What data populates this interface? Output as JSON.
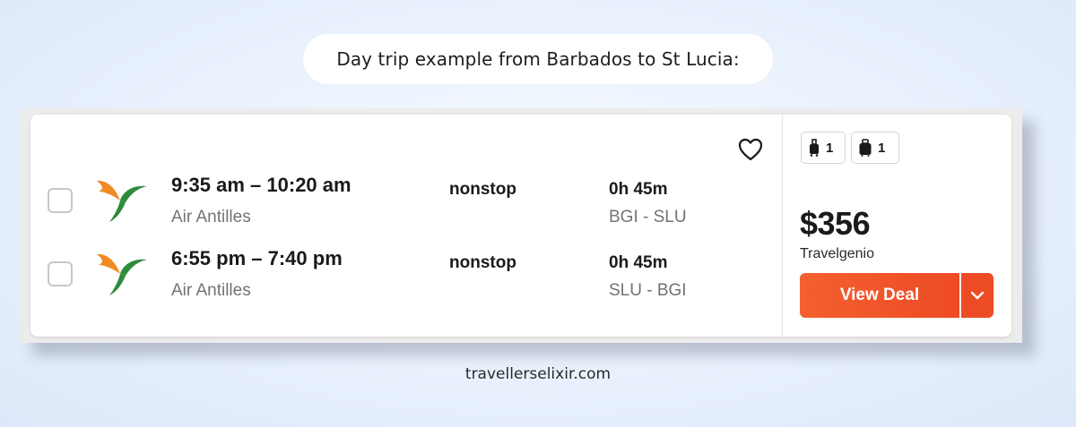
{
  "caption": "Day trip example from Barbados to St Lucia:",
  "legs": [
    {
      "times": "9:35 am – 10:20 am",
      "airline": "Air Antilles",
      "stops": "nonstop",
      "duration": "0h 45m",
      "route": "BGI - SLU"
    },
    {
      "times": "6:55 pm – 7:40 pm",
      "airline": "Air Antilles",
      "stops": "nonstop",
      "duration": "0h 45m",
      "route": "SLU - BGI"
    }
  ],
  "bags": {
    "carry_on_count": "1",
    "checked_count": "1"
  },
  "price": "$356",
  "provider": "Travelgenio",
  "deal_button_label": "View Deal",
  "footer": "travellerselixir.com",
  "colors": {
    "accent": "#ed4b24",
    "logo_orange": "#f08a24",
    "logo_green": "#2e8b3a"
  },
  "icons": {
    "favorite": "heart-icon",
    "carry_on": "carry-on-bag-icon",
    "checked": "checked-bag-icon",
    "dropdown": "chevron-down-icon",
    "airline_logo": "air-antilles-logo"
  }
}
